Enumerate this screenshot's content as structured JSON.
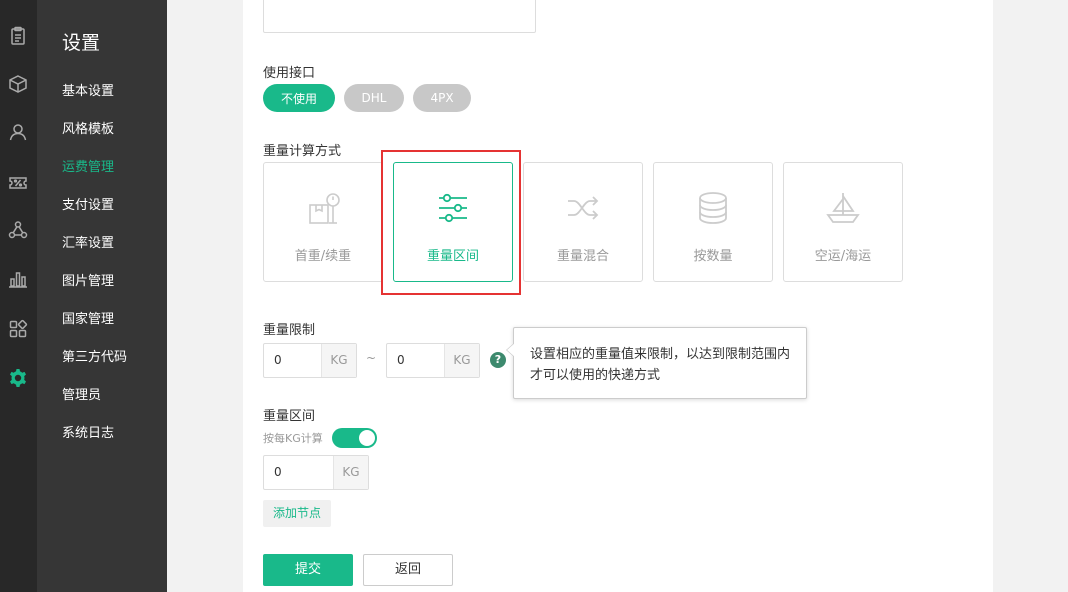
{
  "iconbar": {
    "icons": [
      "clipboard-icon",
      "box-icon",
      "user-icon",
      "discount-icon",
      "network-icon",
      "chart-icon",
      "apps-icon",
      "gear-icon"
    ],
    "active_color": "#19b98a"
  },
  "sidebar": {
    "title": "设置",
    "items": [
      {
        "label": "基本设置"
      },
      {
        "label": "风格模板"
      },
      {
        "label": "运费管理",
        "active": true
      },
      {
        "label": "支付设置"
      },
      {
        "label": "汇率设置"
      },
      {
        "label": "图片管理"
      },
      {
        "label": "国家管理"
      },
      {
        "label": "第三方代码"
      },
      {
        "label": "管理员"
      },
      {
        "label": "系统日志"
      }
    ]
  },
  "form": {
    "top_input_value": "",
    "api_label": "使用接口",
    "api_options": [
      {
        "label": "不使用",
        "selected": true
      },
      {
        "label": "DHL",
        "selected": false
      },
      {
        "label": "4PX",
        "selected": false
      }
    ],
    "calc_label": "重量计算方式",
    "calc_methods": [
      {
        "label": "首重/续重",
        "icon": "scale-box-icon"
      },
      {
        "label": "重量区间",
        "icon": "sliders-icon",
        "selected": true
      },
      {
        "label": "重量混合",
        "icon": "shuffle-icon"
      },
      {
        "label": "按数量",
        "icon": "database-icon"
      },
      {
        "label": "空运/海运",
        "icon": "ship-icon"
      }
    ],
    "limit_label": "重量限制",
    "limit_min": "0",
    "limit_max": "0",
    "unit": "KG",
    "tilde": "~",
    "help_mark": "?",
    "tooltip": "设置相应的重量值来限制，以达到限制范围内才可以使用的快递方式",
    "range_label": "重量区间",
    "per_kg_label": "按每KG计算",
    "per_kg_enabled": true,
    "range_value": "0",
    "add_node": "添加节点",
    "submit": "提交",
    "back": "返回"
  },
  "colors": {
    "accent": "#19b98a",
    "highlight_box": "#e53333",
    "pill_off": "#c8c8c8"
  }
}
